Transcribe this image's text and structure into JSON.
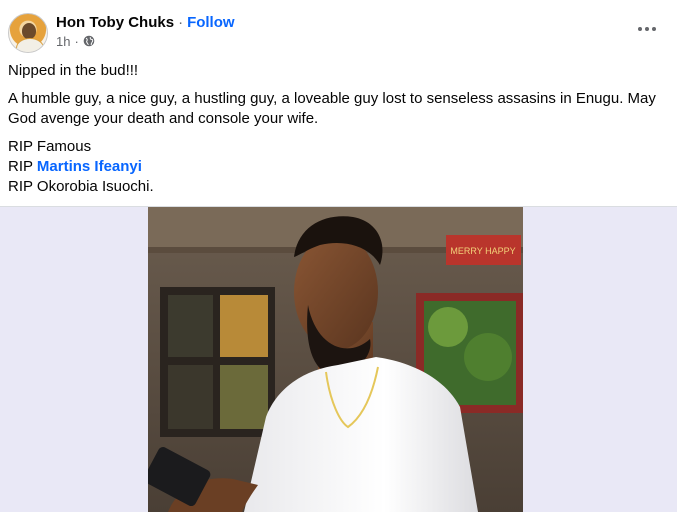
{
  "post": {
    "author": "Hon Toby Chuks",
    "separator": "·",
    "follow_label": "Follow",
    "time": "1h",
    "audience_icon": "globe-icon",
    "more_icon": "more-options-icon",
    "paragraphs": [
      "Nipped in the bud!!!",
      "A humble guy, a nice guy, a hustling guy, a loveable guy lost to senseless assasins in Enugu. May God avenge your death and console your wife."
    ],
    "rip_lines": [
      {
        "prefix": "RIP",
        "name": "Famous",
        "is_mention": false
      },
      {
        "prefix": "RIP",
        "name": "Martins Ifeanyi",
        "is_mention": true
      },
      {
        "prefix": "RIP",
        "name": "Okorobia Isuochi.",
        "is_mention": false
      }
    ]
  },
  "photo": {
    "sign_text": "MERRY HAPPY"
  },
  "colors": {
    "link": "#0866ff",
    "text": "#050505",
    "secondary": "#65676b",
    "backdrop": "#e9e8f6"
  }
}
